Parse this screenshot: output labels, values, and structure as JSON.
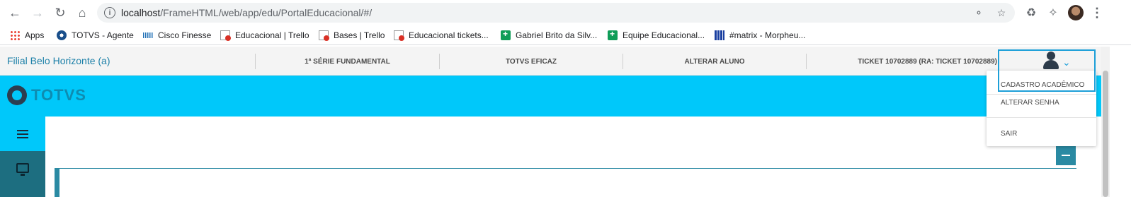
{
  "browser": {
    "url_host": "localhost",
    "url_path": "/FrameHTML/web/app/edu/PortalEducacional/#/",
    "icons": [
      "back-icon",
      "forward-icon",
      "reload-icon",
      "home-icon",
      "info-icon",
      "key-icon",
      "star-icon",
      "recycle-icon",
      "puzzle-icon",
      "profile-avatar",
      "more-icon"
    ]
  },
  "bookmarks": [
    {
      "label": "Apps",
      "icon": "apps-icon"
    },
    {
      "label": "TOTVS - Agente",
      "icon": "totvs-icon"
    },
    {
      "label": "Cisco Finesse",
      "icon": "cisco-icon"
    },
    {
      "label": "Educacional | Trello",
      "icon": "trello-icon"
    },
    {
      "label": "Bases | Trello",
      "icon": "trello-icon"
    },
    {
      "label": "Educacional tickets...",
      "icon": "trello-icon"
    },
    {
      "label": "Gabriel Brito da Silv...",
      "icon": "sheets-icon"
    },
    {
      "label": "Equipe Educacional...",
      "icon": "sheets-icon"
    },
    {
      "label": "#matrix - Morpheu...",
      "icon": "matrix-icon"
    }
  ],
  "topbar": {
    "filial": "Filial Belo Horizonte (a)",
    "context": [
      "1ª SÉRIE FUNDAMENTAL",
      "TOTVS EFICAZ",
      "ALTERAR ALUNO",
      "TICKET 10702889 (RA: TICKET 10702889)"
    ]
  },
  "brand": {
    "logo_text": "TOTVS",
    "band_color": "#00c8fa",
    "accent_color": "#1d9fd8"
  },
  "user_menu": {
    "items": [
      "CADASTRO ACADÊMICO",
      "ALTERAR SENHA",
      "SAIR"
    ]
  }
}
